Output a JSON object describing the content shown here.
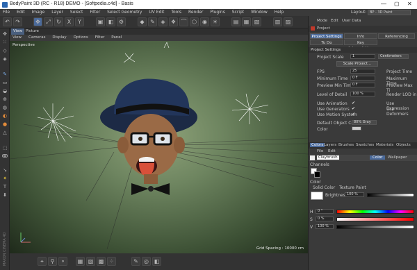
{
  "window": {
    "title": "BodyPaint 3D (RC - R18) DEMO - [Softpedia.c4d] - Basis",
    "controls": [
      "—",
      "▢",
      "✕"
    ]
  },
  "menu": [
    "File",
    "Edit",
    "Image",
    "Layer",
    "Select",
    "Filter",
    "Select Geometry",
    "UV Edit",
    "Tools",
    "Render",
    "Plugins",
    "Script",
    "Window",
    "Help"
  ],
  "layout": {
    "label": "Layout:",
    "value": "BP - 3D Paint"
  },
  "view": {
    "tabs": [
      "View",
      "Picture"
    ],
    "menu": [
      "View",
      "Cameras",
      "Display",
      "Options",
      "Filter",
      "Panel"
    ],
    "label": "Perspective",
    "grid_spacing": "Grid Spacing : 10000 cm"
  },
  "left_watermark": "MAXON CINEMA 4D",
  "attributes": {
    "menu": [
      "Mode",
      "Edit",
      "User Data"
    ],
    "object_name": "Project",
    "tabs": [
      "Project Settings",
      "Info",
      "Referencing",
      "To Do",
      "Key Interpolation"
    ],
    "section": "Project Settings",
    "project_scale": {
      "label": "Project Scale",
      "value": "1",
      "unit": "Centimeters"
    },
    "scale_button": "Scale Project...",
    "rows": [
      {
        "label": "FPS",
        "value": "25",
        "right_label": "Project Time"
      },
      {
        "label": "Minimum Time",
        "value": "0 F",
        "right_label": "Maximum Time"
      },
      {
        "label": "Preview Min Time",
        "value": "0 F",
        "right_label": "Preview Max Ti"
      },
      {
        "label": "Level of Detail",
        "value": "100 %",
        "right_label": "Render LOD in"
      }
    ],
    "checks": [
      {
        "label": "Use Animation",
        "value": "✔",
        "right_label": "Use Expression"
      },
      {
        "label": "Use Generators",
        "value": "✔",
        "right_label": "Use Deformers"
      },
      {
        "label": "Use Motion System",
        "value": "✔"
      }
    ],
    "default_color": {
      "label": "Default Object Color",
      "value": "80% Gray"
    },
    "color_label": "Color"
  },
  "colors_panel": {
    "tabs": [
      "Colors",
      "Layers",
      "Brushes",
      "Swatches",
      "Materials",
      "Objects"
    ],
    "menu": [
      "File",
      "Edit"
    ],
    "material_items": [
      "Claybrush",
      "Color",
      "Wallpaper"
    ],
    "channels_label": "Channels",
    "color_label": "Color",
    "modes": [
      "Solid Color",
      "Texture Paint"
    ],
    "brightness_label": "Brightness",
    "brightness_value": "100 %",
    "sliders": [
      {
        "label": "H",
        "value": "0 °"
      },
      {
        "label": "S",
        "value": "0 %"
      },
      {
        "label": "V",
        "value": "100 %"
      }
    ],
    "colors": {
      "accent": "#2a66b0"
    }
  }
}
